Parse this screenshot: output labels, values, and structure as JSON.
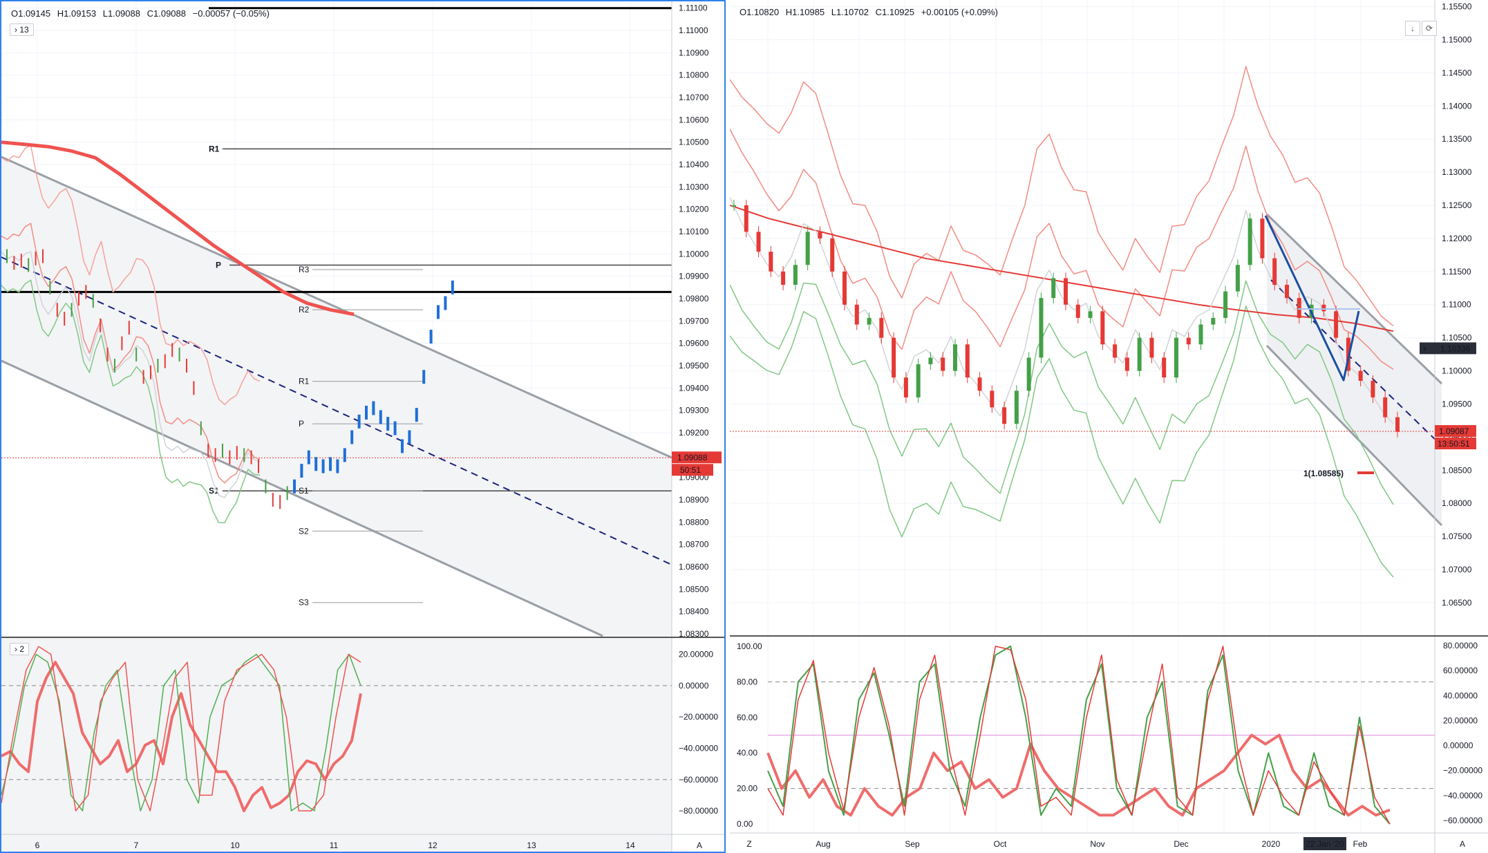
{
  "left": {
    "ohlc": {
      "o": "O1.09145",
      "h": "H1.09153",
      "l": "L1.09088",
      "c": "C1.09088",
      "chg": "−0.00057 (−0.05%)"
    },
    "interval_badge": "13",
    "osc_badge": "2",
    "price_label": "1.09088",
    "countdown": "50:51",
    "axis_button": "A"
  },
  "right": {
    "ohlc": {
      "o": "O1.10820",
      "h": "H1.10985",
      "l": "L1.10702",
      "c": "C1.10925",
      "chg": "+0.00105 (+0.09%)"
    },
    "price_label": "1.09087",
    "countdown": "13:50:51",
    "crosshair_label": "1.10336",
    "target_label": "1(1.08585)",
    "date_label": "22 Jan '20",
    "axis_button": "A",
    "z_button": "Z"
  },
  "chart_data": [
    {
      "type": "line",
      "panel": "left-price",
      "y_ticks": [
        "1.11100",
        "1.11000",
        "1.10900",
        "1.10800",
        "1.10700",
        "1.10600",
        "1.10500",
        "1.10400",
        "1.10300",
        "1.10200",
        "1.10100",
        "1.10000",
        "1.09900",
        "1.09800",
        "1.09700",
        "1.09600",
        "1.09500",
        "1.09400",
        "1.09300",
        "1.09200",
        "1.09100",
        "1.09000",
        "1.08900",
        "1.08800",
        "1.08700",
        "1.08600",
        "1.08500",
        "1.08400",
        "1.08300"
      ],
      "ylim": [
        1.083,
        1.1113
      ],
      "x_ticks": [
        "6",
        "7",
        "10",
        "11",
        "12",
        "13",
        "14"
      ],
      "pivots": [
        {
          "label": "R1",
          "value": 1.1047
        },
        {
          "label": "P",
          "value": 1.0995
        },
        {
          "label": "R3",
          "value": 1.0993
        },
        {
          "label": "R2",
          "value": 1.0975
        },
        {
          "label": "R1",
          "value": 1.0943
        },
        {
          "label": "P",
          "value": 1.0924
        },
        {
          "label": "S1",
          "value": 1.0894
        },
        {
          "label": "S1",
          "value": 1.0894
        },
        {
          "label": "S2",
          "value": 1.0876
        },
        {
          "label": "S3",
          "value": 1.0844
        }
      ],
      "horizontal_lines": [
        1.111,
        1.0983
      ],
      "last_price": 1.09088,
      "price_path": [
        1.0999,
        1.0996,
        1.0997,
        1.0995,
        1.0998,
        1.0999,
        1.0985,
        1.0975,
        1.0971,
        1.0975,
        1.098,
        1.0983,
        1.0979,
        1.0968,
        1.0955,
        1.095,
        1.096,
        1.0967,
        1.0955,
        1.0945,
        1.0947,
        1.095,
        1.0952,
        1.0957,
        1.0955,
        1.095,
        1.094,
        1.0922,
        1.0912,
        1.091,
        1.0912,
        1.0909,
        1.0911,
        1.091,
        1.0909,
        1.0905,
        1.0896,
        1.089,
        1.0889,
        1.0893,
        1.0896,
        1.0903,
        1.0909,
        1.0906,
        1.0905,
        1.0906,
        1.0905,
        1.091,
        1.0918,
        1.0925,
        1.0929,
        1.0931,
        1.0927,
        1.0924,
        1.0922,
        1.0914,
        1.0918,
        1.0928,
        1.0945,
        1.0963,
        1.0974,
        1.0978,
        1.0985
      ]
    },
    {
      "type": "line",
      "panel": "left-oscillator",
      "y_ticks": [
        "20.00000",
        "0.00000",
        "−20.00000",
        "−40.00000",
        "−60.00000",
        "−80.00000"
      ],
      "ylim": [
        -95,
        30
      ],
      "levels": [
        0,
        -60
      ],
      "series": [
        {
          "values": [
            -45,
            -42,
            -50,
            -55,
            -10,
            5,
            15,
            5,
            -5,
            -30,
            -40,
            -50,
            -45,
            -35,
            -55,
            -50,
            -38,
            -35,
            -50,
            -20,
            -5,
            -25,
            -35,
            -45,
            -55,
            -55,
            -65,
            -80,
            -70,
            -65,
            -78,
            -75,
            -70,
            -55,
            -48,
            -50,
            -60,
            -50,
            -45,
            -35,
            -5
          ]
        },
        {
          "values": [
            -70,
            -40,
            0,
            20,
            15,
            -10,
            -70,
            -80,
            -30,
            0,
            10,
            -40,
            -80,
            -60,
            0,
            10,
            -60,
            -75,
            -20,
            0,
            5,
            15,
            20,
            10,
            0,
            -80,
            -75,
            -80,
            -40,
            10,
            20,
            0
          ]
        },
        {
          "values": [
            -75,
            -30,
            10,
            25,
            20,
            -30,
            -80,
            -70,
            -10,
            5,
            15,
            -60,
            -80,
            -40,
            5,
            15,
            -70,
            -70,
            -10,
            10,
            15,
            20,
            10,
            -20,
            -80,
            -80,
            -70,
            -20,
            20,
            15
          ]
        }
      ]
    },
    {
      "type": "line",
      "panel": "right-price",
      "y_ticks": [
        "1.15500",
        "1.15000",
        "1.14500",
        "1.14000",
        "1.13500",
        "1.13000",
        "1.12500",
        "1.12000",
        "1.11500",
        "1.11000",
        "1.10500",
        "1.10000",
        "1.09500",
        "1.09000",
        "1.08500",
        "1.08000",
        "1.07500",
        "1.07000",
        "1.06500"
      ],
      "ylim": [
        1.0605,
        1.156
      ],
      "x_ticks": [
        "Aug",
        "Sep",
        "Oct",
        "Nov",
        "Dec",
        "2020",
        "Feb"
      ],
      "last_price": 1.09087,
      "price_path": [
        1.125,
        1.121,
        1.118,
        1.115,
        1.113,
        1.116,
        1.121,
        1.12,
        1.115,
        1.11,
        1.107,
        1.108,
        1.105,
        1.099,
        1.096,
        1.101,
        1.102,
        1.1,
        1.104,
        1.099,
        1.097,
        1.0945,
        1.092,
        1.097,
        1.102,
        1.111,
        1.114,
        1.11,
        1.108,
        1.109,
        1.104,
        1.102,
        1.1,
        1.105,
        1.102,
        1.099,
        1.105,
        1.104,
        1.107,
        1.108,
        1.112,
        1.116,
        1.123,
        1.117,
        1.113,
        1.111,
        1.108,
        1.11,
        1.109,
        1.105,
        1.1,
        1.0985,
        1.096,
        1.093,
        1.0908
      ]
    },
    {
      "type": "line",
      "panel": "right-oscillator",
      "y_ticks_left": [
        "100.00",
        "80.00",
        "60.00",
        "40.00",
        "20.00",
        "0.00"
      ],
      "y_ticks_right": [
        "80.00000",
        "60.00000",
        "40.00000",
        "20.00000",
        "0.00000",
        "−20.00000",
        "−40.00000",
        "−60.00000"
      ],
      "ylim": [
        -5,
        105
      ],
      "levels": [
        80,
        50,
        20
      ],
      "series": [
        {
          "values": [
            40,
            20,
            30,
            15,
            25,
            10,
            5,
            20,
            10,
            5,
            15,
            20,
            40,
            30,
            35,
            20,
            25,
            15,
            20,
            45,
            30,
            20,
            15,
            10,
            5,
            5,
            10,
            15,
            20,
            10,
            5,
            20,
            25,
            30,
            40,
            50,
            45,
            50,
            30,
            20,
            25,
            15,
            5,
            10,
            5,
            8
          ]
        },
        {
          "values": [
            30,
            10,
            80,
            90,
            30,
            5,
            70,
            85,
            50,
            10,
            80,
            90,
            30,
            10,
            60,
            95,
            100,
            60,
            5,
            20,
            10,
            70,
            90,
            20,
            5,
            60,
            80,
            10,
            5,
            75,
            95,
            30,
            5,
            40,
            10,
            5,
            40,
            10,
            5,
            60,
            10,
            0
          ]
        },
        {
          "values": [
            20,
            5,
            70,
            92,
            40,
            8,
            60,
            88,
            55,
            5,
            70,
            95,
            40,
            5,
            50,
            100,
            98,
            70,
            10,
            15,
            5,
            60,
            95,
            25,
            5,
            50,
            90,
            15,
            5,
            70,
            100,
            40,
            5,
            30,
            15,
            5,
            35,
            20,
            5,
            55,
            15,
            0
          ]
        }
      ]
    }
  ]
}
